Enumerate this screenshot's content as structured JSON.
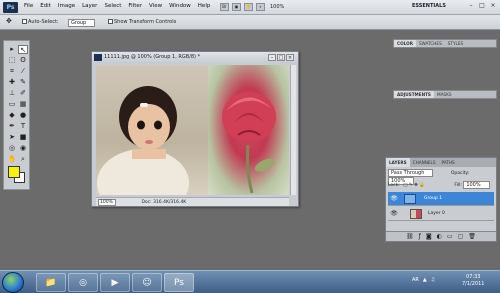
{
  "menubar": {
    "logo": "Ps",
    "items": [
      "File",
      "Edit",
      "Image",
      "Layer",
      "Select",
      "Filter",
      "View",
      "Window",
      "Help"
    ],
    "zoom": "100%",
    "workspace": "ESSENTIALS"
  },
  "options": {
    "auto_select_label": "Auto-Select:",
    "auto_select_value": "Group",
    "transform_label": "Show Transform Controls"
  },
  "document": {
    "title": "11111.jpg @ 100% (Group 1, RGB/8) *",
    "zoom": "100%",
    "doc_info": "Doc: 316.4K/316.4K"
  },
  "panels": {
    "color_tabs": [
      "COLOR",
      "SWATCHES",
      "STYLES"
    ],
    "adjust_tabs": [
      "ADJUSTMENTS",
      "MASKS"
    ]
  },
  "layers": {
    "tabs": [
      "LAYERS",
      "CHANNELS",
      "PATHS"
    ],
    "blend_mode": "Pass Through",
    "opacity_label": "Opacity:",
    "opacity": "100%",
    "lock_label": "Lock:",
    "fill_label": "Fill:",
    "fill": "100%",
    "rows": [
      {
        "name": "Group 1"
      },
      {
        "name": "Layer 0"
      }
    ]
  },
  "taskbar": {
    "tray_lang": "AR",
    "time": "07:33",
    "date": "7/1/2011"
  },
  "colors": {
    "foreground": "#f7f20a",
    "background": "#ffffff",
    "selected_layer": "#3d85d6"
  }
}
